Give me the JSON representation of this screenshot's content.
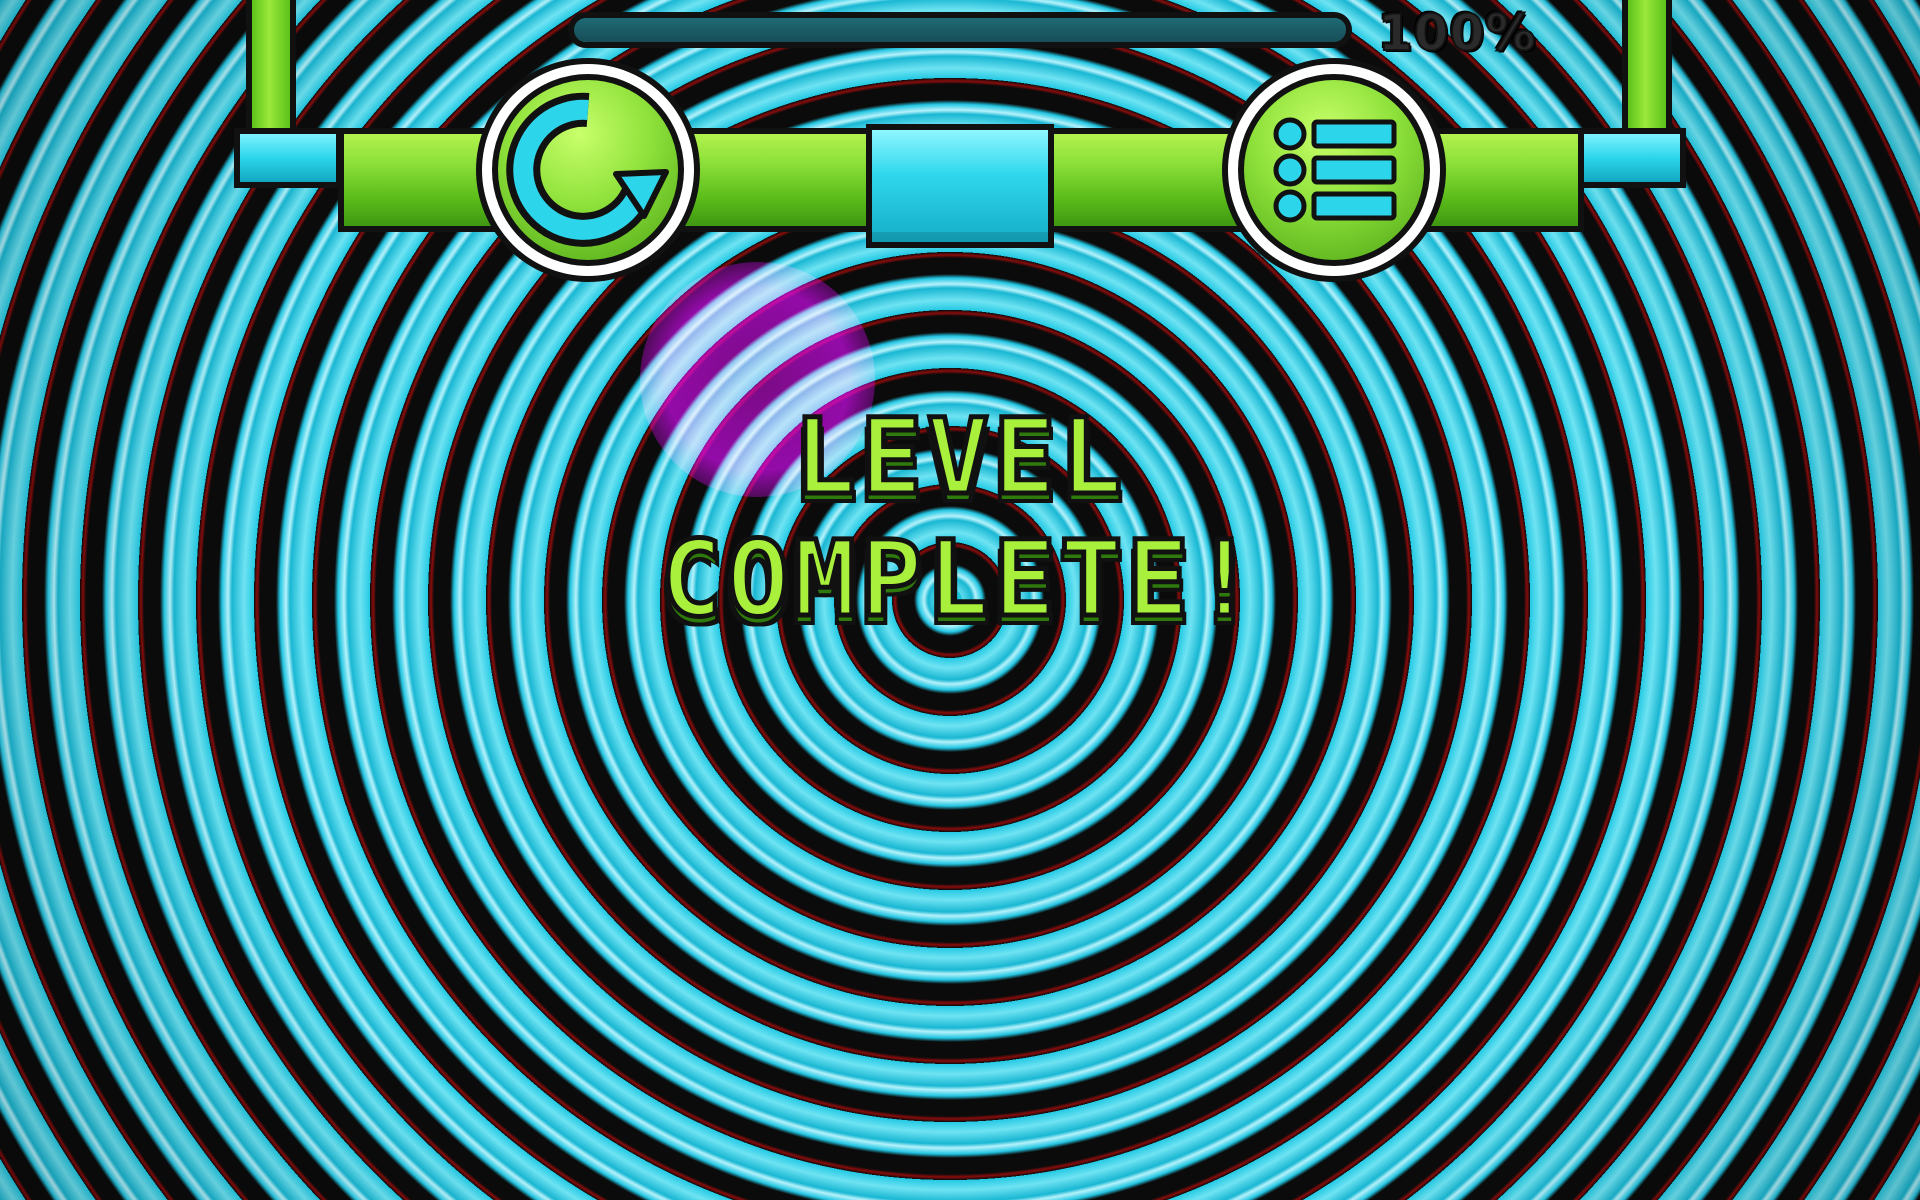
{
  "hud": {
    "progress_text": "100%",
    "progress_fraction": 1.0
  },
  "buttons": {
    "retry_icon": "retry-arrow-icon",
    "menu_icon": "list-menu-icon"
  },
  "title": "LEVEL COMPLETE!",
  "colors": {
    "frame_green": "#8ee13a",
    "accent_cyan": "#2cd5ea",
    "title_green": "#a8f03c",
    "glow_magenta": "#c000e0",
    "outline": "#111111"
  }
}
